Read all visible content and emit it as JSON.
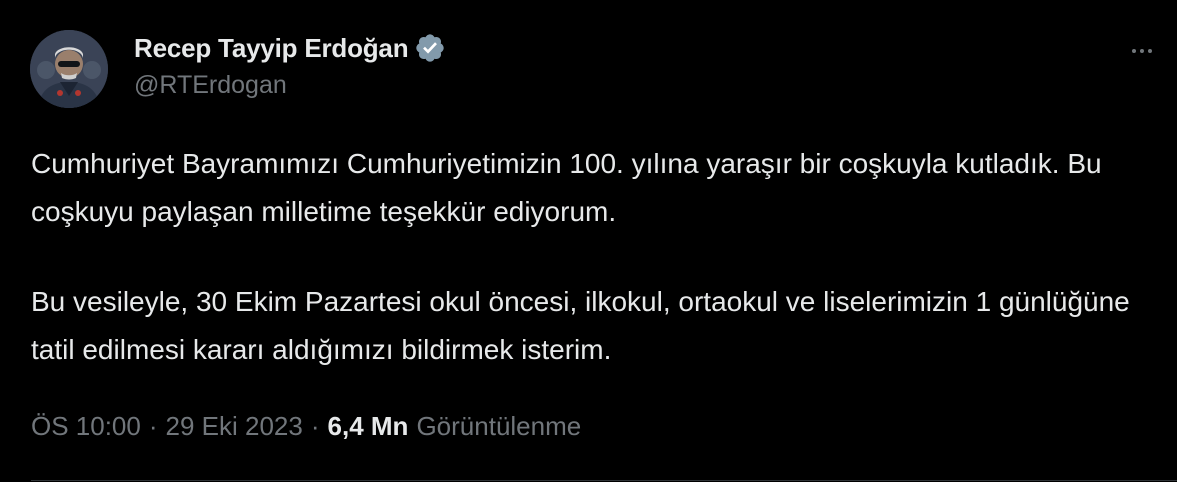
{
  "author": {
    "display_name": "Recep Tayyip Erdoğan",
    "handle": "@RTErdogan",
    "verified_icon": "verified-badge-icon",
    "verified_color": "#829aab"
  },
  "tweet": {
    "paragraphs": [
      "Cumhuriyet Bayramımızı Cumhuriyetimizin 100. yılına yaraşır bir coşkuyla kutladık. Bu coşkuyu paylaşan milletime teşekkür ediyorum.",
      "Bu vesileyle, 30 Ekim Pazartesi okul öncesi, ilkokul, ortaokul ve liselerimizin 1 günlüğüne tatil edilmesi kararı aldığımızı bildirmek isterim."
    ]
  },
  "meta": {
    "time": "ÖS 10:00",
    "separator": "·",
    "date": "29 Eki 2023",
    "views_count": "6,4 Mn",
    "views_label": "Görüntülenme"
  },
  "actions": {
    "more_icon": "more-horizontal-icon"
  },
  "colors": {
    "background": "#000000",
    "text_primary": "#e7e9ea",
    "text_secondary": "#71767b"
  }
}
